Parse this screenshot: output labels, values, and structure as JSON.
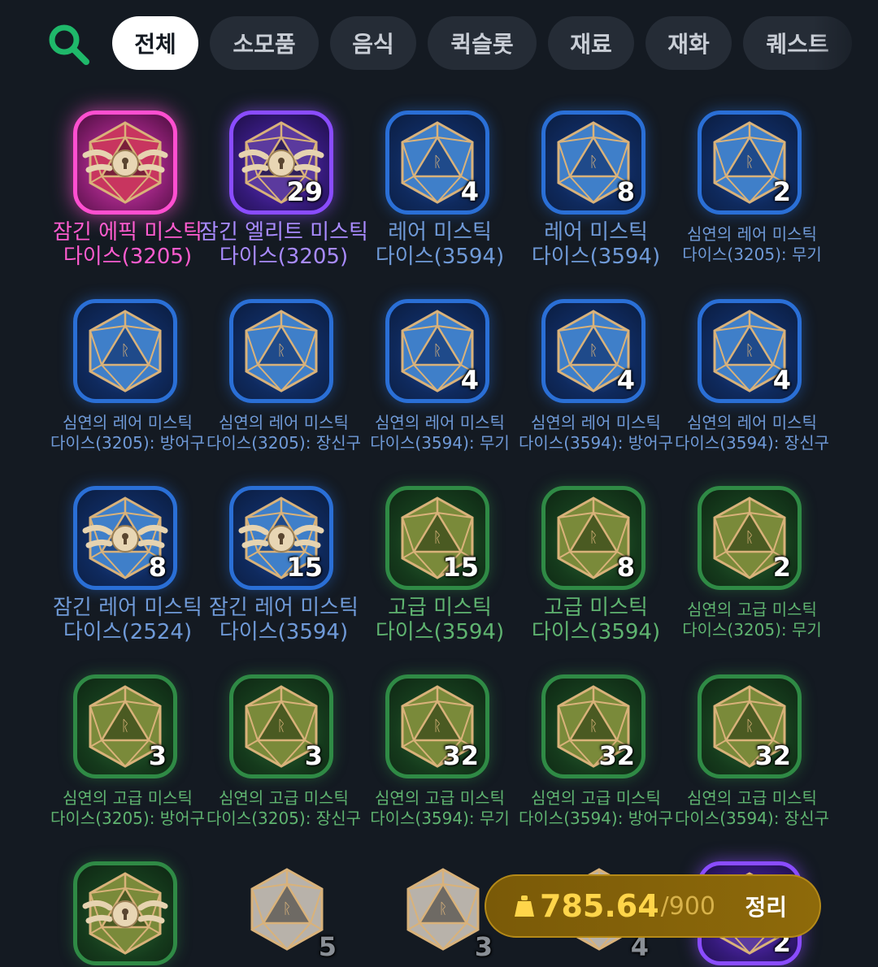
{
  "tabs": [
    {
      "label": "전체",
      "active": true
    },
    {
      "label": "소모품",
      "active": false
    },
    {
      "label": "음식",
      "active": false
    },
    {
      "label": "퀵슬롯",
      "active": false
    },
    {
      "label": "재료",
      "active": false
    },
    {
      "label": "재화",
      "active": false
    },
    {
      "label": "퀘스트",
      "active": false
    }
  ],
  "colors": {
    "accent_search": "#1fb86a",
    "epic": "#ff5ccf",
    "elite": "#a98bff",
    "rare": "#6f9ad8",
    "advanced": "#5fb470",
    "weight": "#ffd54a"
  },
  "items": [
    {
      "name": "잠긴 에픽 미스틱 다이스(3205)",
      "count": "",
      "grade": "epic",
      "locked": true
    },
    {
      "name": "잠긴 엘리트 미스틱 다이스(3205)",
      "count": "29",
      "grade": "elite",
      "locked": true
    },
    {
      "name": "레어 미스틱 다이스(3594)",
      "count": "4",
      "grade": "rare",
      "locked": false
    },
    {
      "name": "레어 미스틱 다이스(3594)",
      "count": "8",
      "grade": "rare",
      "locked": false
    },
    {
      "name": "심연의 레어 미스틱 다이스(3205): 무기",
      "count": "2",
      "grade": "rare",
      "locked": false
    },
    {
      "name": "심연의 레어 미스틱 다이스(3205): 방어구",
      "count": "",
      "grade": "rare",
      "locked": false
    },
    {
      "name": "심연의 레어 미스틱 다이스(3205): 장신구",
      "count": "",
      "grade": "rare",
      "locked": false
    },
    {
      "name": "심연의 레어 미스틱 다이스(3594): 무기",
      "count": "4",
      "grade": "rare",
      "locked": false
    },
    {
      "name": "심연의 레어 미스틱 다이스(3594): 방어구",
      "count": "4",
      "grade": "rare",
      "locked": false
    },
    {
      "name": "심연의 레어 미스틱 다이스(3594): 장신구",
      "count": "4",
      "grade": "rare",
      "locked": false
    },
    {
      "name": "잠긴 레어 미스틱 다이스(2524)",
      "count": "8",
      "grade": "rare",
      "locked": true
    },
    {
      "name": "잠긴 레어 미스틱 다이스(3594)",
      "count": "15",
      "grade": "rare",
      "locked": true
    },
    {
      "name": "고급 미스틱 다이스(3594)",
      "count": "15",
      "grade": "advanced",
      "locked": false
    },
    {
      "name": "고급 미스틱 다이스(3594)",
      "count": "8",
      "grade": "advanced",
      "locked": false
    },
    {
      "name": "심연의 고급 미스틱 다이스(3205): 무기",
      "count": "2",
      "grade": "advanced",
      "locked": false
    },
    {
      "name": "심연의 고급 미스틱 다이스(3205): 방어구",
      "count": "3",
      "grade": "advanced",
      "locked": false
    },
    {
      "name": "심연의 고급 미스틱 다이스(3205): 장신구",
      "count": "3",
      "grade": "advanced",
      "locked": false
    },
    {
      "name": "심연의 고급 미스틱 다이스(3594): 무기",
      "count": "32",
      "grade": "advanced",
      "locked": false
    },
    {
      "name": "심연의 고급 미스틱 다이스(3594): 방어구",
      "count": "32",
      "grade": "advanced",
      "locked": false
    },
    {
      "name": "심연의 고급 미스틱 다이스(3594): 장신구",
      "count": "32",
      "grade": "advanced",
      "locked": false
    },
    {
      "name": "",
      "count": "",
      "grade": "advanced",
      "locked": true
    },
    {
      "name": "",
      "count": "5",
      "grade": "common",
      "locked": false
    },
    {
      "name": "",
      "count": "3",
      "grade": "common",
      "locked": false
    },
    {
      "name": "",
      "count": "4",
      "grade": "common",
      "locked": false
    },
    {
      "name": "",
      "count": "2",
      "grade": "elite",
      "locked": false
    }
  ],
  "item_labels": [
    [
      "잠긴 에픽 미스틱",
      "다이스(3205)"
    ],
    [
      "잠긴 엘리트 미스틱",
      "다이스(3205)"
    ],
    [
      "레어 미스틱",
      "다이스(3594)"
    ],
    [
      "레어 미스틱",
      "다이스(3594)"
    ],
    [
      "심연의 레어 미스틱",
      "다이스(3205): 무기"
    ],
    [
      "심연의 레어 미스틱",
      "다이스(3205): 방어구"
    ],
    [
      "심연의 레어 미스틱",
      "다이스(3205): 장신구"
    ],
    [
      "심연의 레어 미스틱",
      "다이스(3594): 무기"
    ],
    [
      "심연의 레어 미스틱",
      "다이스(3594): 방어구"
    ],
    [
      "심연의 레어 미스틱",
      "다이스(3594): 장신구"
    ],
    [
      "잠긴 레어 미스틱",
      "다이스(2524)"
    ],
    [
      "잠긴 레어 미스틱",
      "다이스(3594)"
    ],
    [
      "고급 미스틱",
      "다이스(3594)"
    ],
    [
      "고급 미스틱",
      "다이스(3594)"
    ],
    [
      "심연의 고급 미스틱",
      "다이스(3205): 무기"
    ],
    [
      "심연의 고급 미스틱",
      "다이스(3205): 방어구"
    ],
    [
      "심연의 고급 미스틱",
      "다이스(3205): 장신구"
    ],
    [
      "심연의 고급 미스틱",
      "다이스(3594): 무기"
    ],
    [
      "심연의 고급 미스틱",
      "다이스(3594): 방어구"
    ],
    [
      "심연의 고급 미스틱",
      "다이스(3594): 장신구"
    ],
    [
      "",
      ""
    ],
    [
      "",
      ""
    ],
    [
      "",
      ""
    ],
    [
      "",
      ""
    ],
    [
      "",
      ""
    ]
  ],
  "weight": {
    "current": "785.64",
    "max": "/900",
    "icon": "weight-icon"
  },
  "sort_label": "정리"
}
